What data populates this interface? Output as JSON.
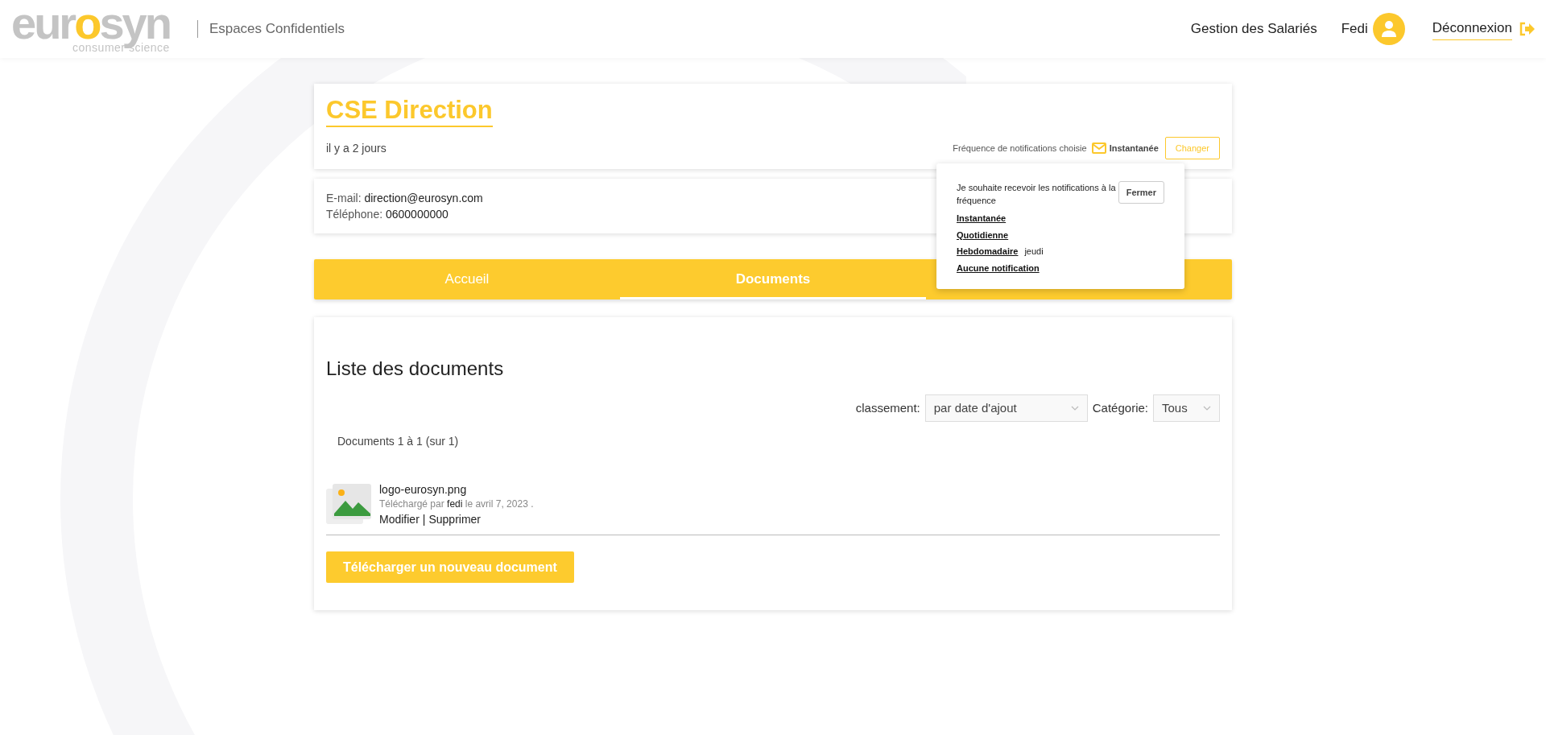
{
  "header": {
    "logo": {
      "parts": [
        {
          "text": "eur",
          "accent": false
        },
        {
          "text": "o",
          "accent": true
        },
        {
          "text": "syn",
          "accent": false
        }
      ],
      "tagline": "consumer science"
    },
    "section": "Espaces Confidentiels",
    "nav": [
      "Gestion des Salariés"
    ],
    "user": "Fedi",
    "logout": "Déconnexion"
  },
  "space": {
    "title": "CSE Direction",
    "age": "il y a 2 jours",
    "frequency_label": "Fréquence de notifications choisie",
    "frequency_value": "Instantanée",
    "change_button": "Changer"
  },
  "contact": [
    {
      "label": "E-mail:",
      "value": "direction@eurosyn.com"
    },
    {
      "label": "Téléphone:",
      "value": "0600000000"
    }
  ],
  "popup": {
    "open": true,
    "text": "Je souhaite recevoir les notifications à la fréquence",
    "close_button": "Fermer",
    "options": [
      {
        "label": "Instantanée"
      },
      {
        "label": "Quotidienne"
      },
      {
        "label": "Hebdomadaire",
        "note": "jeudi"
      },
      {
        "label": "Aucune notification"
      }
    ]
  },
  "tabs": [
    {
      "label": "Accueil",
      "selected": false
    },
    {
      "label": "Documents",
      "selected": true
    }
  ],
  "documents": {
    "title": "Liste des documents",
    "sort_label": "classement:",
    "sort_value": "par date d'ajout",
    "category_label": "Catégorie:",
    "category_value": "Tous",
    "count": "Documents 1 à 1 (sur 1)",
    "items": [
      {
        "name": "logo-eurosyn.png",
        "uploaded_prefix": "Téléchargé par",
        "uploader": "fedi",
        "uploaded_suffix": "le avril 7, 2023 .",
        "edit": "Modifier",
        "separator": "|",
        "delete": "Supprimer"
      }
    ],
    "upload_button": "Télécharger un nouveau document"
  }
}
